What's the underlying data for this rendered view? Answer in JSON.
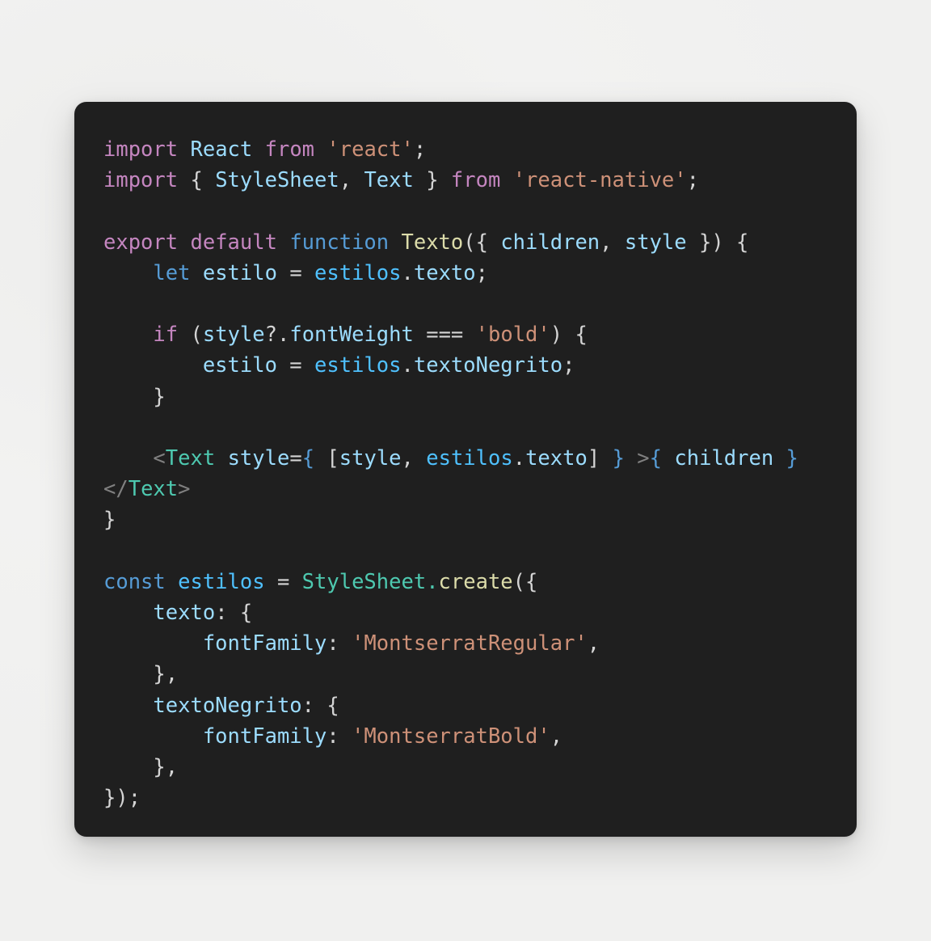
{
  "window": {
    "background_color": "#f1f1f0",
    "card_background_color": "#1f1f1f",
    "card_corner_radius": "15px"
  },
  "palette": {
    "keyword": "#c586c0",
    "control": "#569cd6",
    "variable": "#9cdcfe",
    "variable_bright": "#4fc1ff",
    "string": "#ce9178",
    "function": "#dcdcaa",
    "type": "#4ec9b0",
    "punctuation": "#d4d4d4",
    "dim": "#808080"
  },
  "code": {
    "language": "jsx",
    "full_text": "import React from 'react';\nimport { StyleSheet, Text } from 'react-native';\n\nexport default function Texto({ children, style }) {\n    let estilo = estilos.texto;\n\n    if (style?.fontWeight === 'bold') {\n        estilo = estilos.textoNegrito;\n    }\n\n    <Text style={ [style, estilos.texto] } >{ children }</Text>\n}\n\nconst estilos = StyleSheet.create({\n    texto: {\n        fontFamily: 'MontserratRegular',\n    },\n    textoNegrito: {\n        fontFamily: 'MontserratBold',\n    },\n});",
    "lines": [
      {
        "id": "l1",
        "text": "import React from 'react';"
      },
      {
        "id": "l2",
        "text": "import { StyleSheet, Text } from 'react-native';"
      },
      {
        "id": "l3",
        "text": ""
      },
      {
        "id": "l4",
        "text": "export default function Texto({ children, style }) {"
      },
      {
        "id": "l5",
        "text": "    let estilo = estilos.texto;"
      },
      {
        "id": "l6",
        "text": ""
      },
      {
        "id": "l7",
        "text": "    if (style?.fontWeight === 'bold') {"
      },
      {
        "id": "l8",
        "text": "        estilo = estilos.textoNegrito;"
      },
      {
        "id": "l9",
        "text": "    }"
      },
      {
        "id": "l10",
        "text": ""
      },
      {
        "id": "l11",
        "text": "    <Text style={ [style, estilos.texto] } >{ children }</Text>"
      },
      {
        "id": "l12",
        "text": "}"
      },
      {
        "id": "l13",
        "text": ""
      },
      {
        "id": "l14",
        "text": "const estilos = StyleSheet.create({"
      },
      {
        "id": "l15",
        "text": "    texto: {"
      },
      {
        "id": "l16",
        "text": "        fontFamily: 'MontserratRegular',"
      },
      {
        "id": "l17",
        "text": "    },"
      },
      {
        "id": "l18",
        "text": "    textoNegrito: {"
      },
      {
        "id": "l19",
        "text": "        fontFamily: 'MontserratBold',"
      },
      {
        "id": "l20",
        "text": "    },"
      },
      {
        "id": "l21",
        "text": "});"
      }
    ],
    "tokens": {
      "kw_import": "import",
      "kw_from": "from",
      "kw_export": "export",
      "kw_default": "default",
      "kw_if": "if",
      "kw_let": "let",
      "kw_const": "const",
      "kw_function": "function",
      "id_React": "React",
      "id_StyleSheet": "StyleSheet",
      "id_Text": "Text",
      "id_Texto": "Texto",
      "id_children": "children",
      "id_style": "style",
      "id_estilo": "estilo",
      "id_estilos": "estilos",
      "id_texto": "texto",
      "id_textoNegrito": "textoNegrito",
      "id_fontWeight": "fontWeight",
      "id_fontFamily": "fontFamily",
      "id_create": "create",
      "str_react": "'react'",
      "str_react_native": "'react-native'",
      "str_bold": "'bold'",
      "str_montserrat_regular": "'MontserratRegular'",
      "str_montserrat_bold": "'MontserratBold'"
    }
  }
}
